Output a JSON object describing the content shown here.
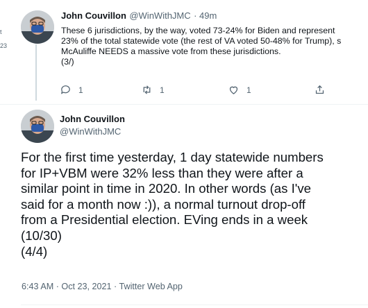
{
  "tweet3": {
    "author_name": "John Couvillon",
    "author_handle": "@WinWithJMC",
    "time": "· 49m",
    "text": "These 6 jurisdictions, by the way, voted 73-24% for Biden and represent\n23% of the total statewide vote (the rest of VA voted 50-48% for Trump), s\nMcAuliffe NEEDS a massive vote from these jurisdictions.\n(3/)",
    "replies": "1",
    "retweets": "1",
    "likes": "1"
  },
  "tweet4": {
    "author_name": "John Couvillon",
    "author_handle": "@WinWithJMC",
    "text": "For the first time yesterday, 1 day statewide numbers\nfor IP+VBM were 32% less than they were after a\nsimilar point in time in 2020. In other words (as I've\nsaid for a month now :)), a normal turnout drop-off\nfrom a Presidential election. EVing ends in a week\n(10/30)\n (4/4)",
    "timestamp": "6:43 AM · Oct 23, 2021 · Twitter Web App"
  },
  "left_edge": {
    "line1": "t",
    "line2": "23"
  },
  "colors": {
    "text": "#0f1419",
    "secondary": "#536471",
    "divider": "#eff3f4",
    "mask": "#2f5aa8"
  }
}
